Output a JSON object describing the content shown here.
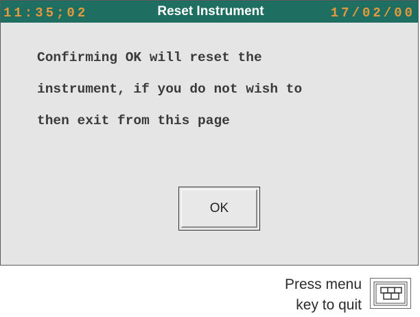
{
  "title_bar": {
    "time": "11:35;02",
    "title": "Reset Instrument",
    "date": "17/02/00",
    "background_color": "#1f6e62",
    "clock_color": "#e39a3c"
  },
  "dialog": {
    "message_lines": [
      "Confirming OK will reset the",
      "instrument, if you do not wish to",
      "then exit from this page"
    ],
    "ok_label": "OK"
  },
  "footer": {
    "hint_lines": [
      "Press menu",
      "key to quit"
    ],
    "menu_key_icon": "menu-key-icon"
  }
}
